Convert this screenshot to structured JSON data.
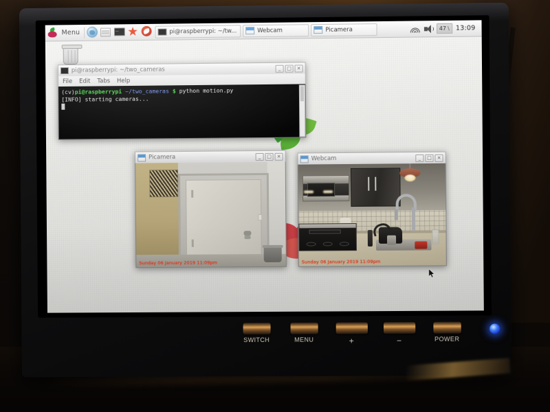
{
  "scene": {
    "description": "Photograph of a small HDMI monitor showing a Raspberry Pi desktop running a dual-camera motion detection script"
  },
  "taskbar": {
    "menu_label": "Menu",
    "launchers": [
      {
        "name": "raspberry-menu-icon",
        "label": "Menu"
      },
      {
        "name": "web-browser-icon",
        "label": "Web Browser"
      },
      {
        "name": "file-manager-icon",
        "label": "File Manager"
      },
      {
        "name": "terminal-icon",
        "label": "Terminal"
      },
      {
        "name": "mathematica-icon",
        "label": "Mathematica"
      },
      {
        "name": "wolfram-icon",
        "label": "Wolfram"
      }
    ],
    "windows": [
      {
        "title": "pi@raspberrypi: ~/tw...",
        "icon": "terminal-icon"
      },
      {
        "title": "Webcam",
        "icon": "camera-window-icon"
      },
      {
        "title": "Picamera",
        "icon": "camera-window-icon"
      }
    ],
    "tray": {
      "wifi_icon": "wifi-icon",
      "volume_icon": "speaker-icon",
      "cpu_value": "47",
      "cpu_spark": "\\",
      "clock": "13:09"
    }
  },
  "desktop": {
    "icons": [
      {
        "name": "wastebasket-icon",
        "label": "Wast"
      }
    ]
  },
  "terminal_window": {
    "title": "pi@raspberrypi: ~/two_cameras",
    "icon": "terminal-icon",
    "buttons": {
      "minimize": "_",
      "maximize": "□",
      "close": "×"
    },
    "menu": [
      "File",
      "Edit",
      "Tabs",
      "Help"
    ],
    "lines": [
      {
        "env": "(cv)",
        "user": "pi@raspberrypi",
        "path": "~/two_cameras",
        "prompt": "$",
        "command": "python motion.py"
      },
      {
        "text": "[INFO] starting cameras..."
      }
    ]
  },
  "picamera_window": {
    "title": "Picamera",
    "icon": "camera-window-icon",
    "buttons": {
      "minimize": "_",
      "maximize": "□",
      "close": "×"
    },
    "timestamp_overlay": "Sunday 06 January 2019 11:09pm",
    "overlay_color": "#f23a20",
    "scene_caption": "Hallway door with wall vent and trash can"
  },
  "webcam_window": {
    "title": "Webcam",
    "icon": "camera-window-icon",
    "buttons": {
      "minimize": "_",
      "maximize": "□",
      "close": "×"
    },
    "timestamp_overlay": "Sunday 06 January 2019 11:09pm",
    "overlay_color": "#f23a20",
    "scene_caption": "Kitchen with microwave, sink faucet and stove"
  },
  "monitor_controls": {
    "buttons": [
      {
        "label": "SWITCH",
        "name": "switch-button"
      },
      {
        "label": "MENU",
        "name": "menu-button"
      },
      {
        "label": "+",
        "name": "plus-button"
      },
      {
        "label": "−",
        "name": "minus-button"
      },
      {
        "label": "POWER",
        "name": "power-button"
      }
    ],
    "led": {
      "name": "power-led",
      "color": "#2f6af0",
      "state": "on"
    }
  }
}
